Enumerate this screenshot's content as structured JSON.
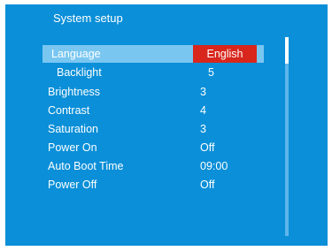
{
  "title": "System setup",
  "menu": [
    {
      "label": "Language",
      "value": "English"
    },
    {
      "label": "Backlight",
      "value": "5"
    },
    {
      "label": "Brightness",
      "value": "3"
    },
    {
      "label": "Contrast",
      "value": "4"
    },
    {
      "label": "Saturation",
      "value": "3"
    },
    {
      "label": "Power On",
      "value": "Off"
    },
    {
      "label": "Auto Boot Time",
      "value": "09:00"
    },
    {
      "label": "Power Off",
      "value": "Off"
    }
  ],
  "selected_index": 0,
  "scroll_position": 0,
  "colors": {
    "background": "#0a8fd8",
    "highlight_row": "#79c6f1",
    "selected_value": "#d8261c",
    "text": "#ffffff"
  }
}
